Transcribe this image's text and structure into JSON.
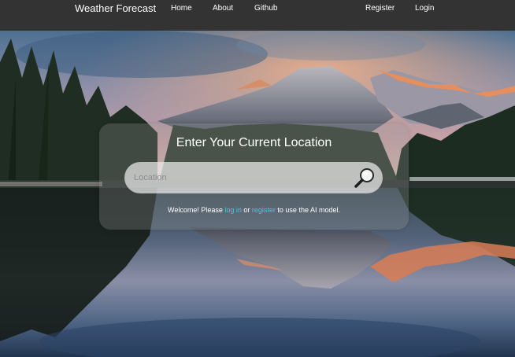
{
  "navbar": {
    "brand": "Weather Forecast",
    "links": {
      "home": "Home",
      "about": "About",
      "github": "Github",
      "register": "Register",
      "login": "Login"
    }
  },
  "search_panel": {
    "title": "Enter Your Current Location",
    "search": {
      "placeholder": "Location",
      "value": ""
    },
    "welcome": {
      "prefix": "Welcome! Please ",
      "login_link": "log in",
      "middle": " or ",
      "register_link": "register",
      "suffix": " to use the AI model."
    }
  },
  "colors": {
    "navbar_bg": "#333333",
    "link_accent": "#4fc3d9",
    "text": "#ffffff"
  },
  "icons": {
    "search": "magnifying-glass-icon"
  }
}
